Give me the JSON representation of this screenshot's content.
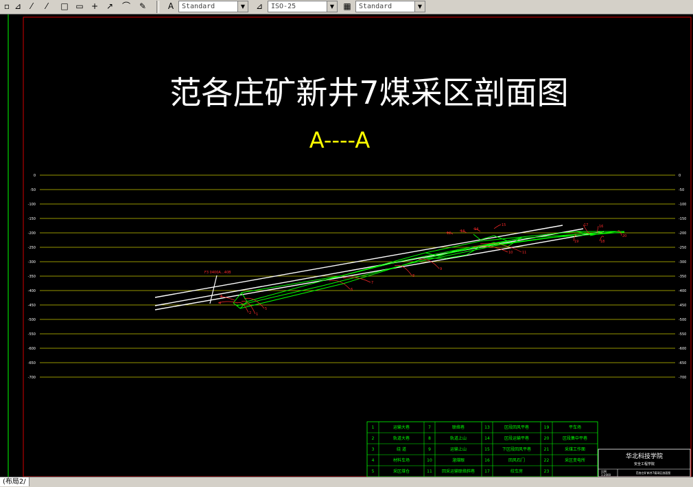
{
  "toolbar": {
    "icons": [
      "dimension-icon",
      "linear-dim-icon",
      "aligned-dim-icon",
      "ordinate-dim-icon",
      "baseline-dim-icon",
      "continue-dim-icon",
      "center-mark-icon",
      "leader-icon",
      "arc-dim-icon",
      "dim-edit-icon"
    ],
    "text_style_value": "Standard",
    "dim_style_value": "ISO-25",
    "table_style_value": "Standard"
  },
  "drawing": {
    "title": "范各庄矿新井7煤采区剖面图",
    "section_label": "A----A",
    "elevations": [
      "0",
      "-50",
      "-100",
      "-150",
      "-200",
      "-250",
      "-300",
      "-350",
      "-400",
      "-450",
      "-500",
      "-550",
      "-600",
      "-650",
      "-700"
    ],
    "fault_label": "F3 0400A…40B",
    "legend": [
      [
        "1",
        "运输大巷",
        "7",
        "联络巷",
        "13",
        "区段回风平巷",
        "19",
        "平车场"
      ],
      [
        "2",
        "轨道大巷",
        "8",
        "轨道上山",
        "14",
        "区段运输平巷",
        "20",
        "区段集中平巷"
      ],
      [
        "3",
        "绕  道",
        "9",
        "运输上山",
        "15",
        "下区段回风平巷",
        "21",
        "采煤工作面"
      ],
      [
        "4",
        "材料车场",
        "10",
        "溜煤眼",
        "16",
        "回风石门",
        "22",
        "采区变电所"
      ],
      [
        "5",
        "采区煤仓",
        "11",
        "回采运输联络斜巷",
        "17",
        "绞车房",
        "23",
        ""
      ]
    ],
    "title_block": {
      "school": "华北科技学院",
      "dept": "安全工程学院",
      "scale_label": "比例",
      "scale": "1:2000",
      "drawing_name": "范各庄矿新井7煤采区剖面图"
    }
  },
  "statusbar": {
    "layout_tab": "布局2"
  },
  "colors": {
    "canvas_bg": "#000000",
    "grid": "#c8c800",
    "title": "#ffffff",
    "section": "#ffff00",
    "seam": "#00ff00",
    "label": "#ff2a2a",
    "border": "#d40000",
    "legend_border": "#00ff00"
  }
}
